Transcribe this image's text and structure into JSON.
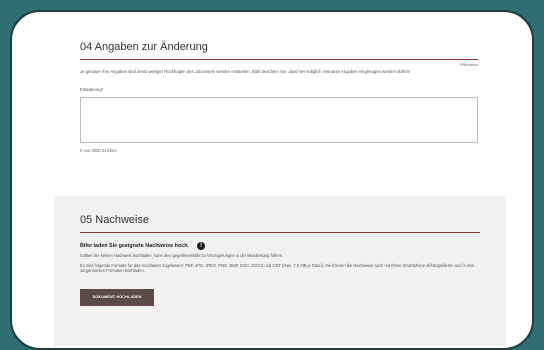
{
  "section_change": {
    "title": "04 Angaben zur Änderung",
    "required_hint": "*Pflichtfeld",
    "intro": "Je genauer Ihre Angaben sind desto weniger Rückfragen des Jobcenters werden entstehen. Bitte beachten Sie, dass hier lediglich relevante Angaben eingetragen werden dürfen!",
    "field_label": "Erläuterung*",
    "textarea_value": "",
    "counter": "0 von 3000 Zeichen"
  },
  "section_proof": {
    "title": "05 Nachweise",
    "heading": "Bitte laden Sie geeignete Nachweise hoch.",
    "info_icon": "info-icon",
    "paragraph1": "Sollten Sie keinen Nachweis hochladen, kann dies gegebenenfalls zu Verzögerungen in der Bearbeitung führen.",
    "paragraph2": "Es sind folgende Formate für das Hochladen zugelassen: PDF, JPG, JPEG, PNG, BMP, DOC, DOCX und ODT (max. 7,5 MB je Datei). Sie können die Nachweise auch mit Ihrem Smartphone abfotografieren und in den vorgenannten Formaten hochladen.",
    "upload_button": "DOKUMENT HOCHLADEN"
  },
  "colors": {
    "page_bg": "#2f6e73",
    "accent_rule": "#8a3b2b",
    "button_bg": "#5b4a45",
    "band_bg": "#f2f1ef"
  }
}
